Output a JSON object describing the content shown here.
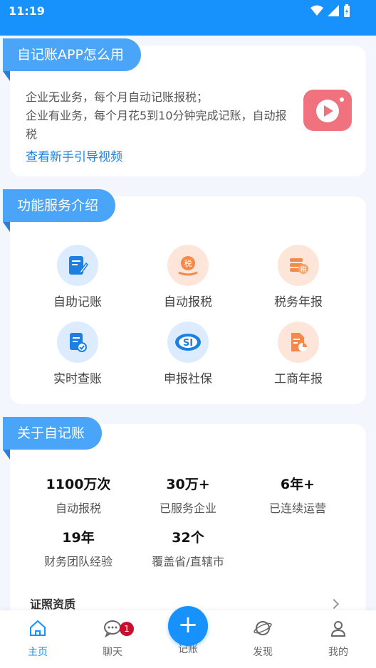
{
  "status": {
    "time": "11:19"
  },
  "intro": {
    "title": "自记账APP怎么用",
    "line1": "企业无业务，每个月自动记账报税；",
    "line2": "企业有业务，每个月花5到10分钟完成记账，自动报税",
    "link": "查看新手引导视频"
  },
  "features": {
    "title": "功能服务介绍",
    "items": [
      {
        "label": "自助记账",
        "icon": "edit-doc-icon",
        "color": "blue"
      },
      {
        "label": "自动报税",
        "icon": "tax-hand-icon",
        "color": "orange"
      },
      {
        "label": "税务年报",
        "icon": "tax-coins-icon",
        "color": "orange"
      },
      {
        "label": "实时查账",
        "icon": "check-doc-icon",
        "color": "blue"
      },
      {
        "label": "申报社保",
        "icon": "social-security-icon",
        "color": "blue"
      },
      {
        "label": "工商年报",
        "icon": "report-chart-icon",
        "color": "orange"
      }
    ],
    "small_tax_char": "税"
  },
  "about": {
    "title": "关于自记账",
    "stats": [
      {
        "num": "1100万次",
        "desc": "自动报税"
      },
      {
        "num": "30万+",
        "desc": "已服务企业"
      },
      {
        "num": "6年+",
        "desc": "已连续运营"
      },
      {
        "num": "19年",
        "desc": "财务团队经验"
      },
      {
        "num": "32个",
        "desc": "覆盖省/直辖市"
      }
    ],
    "license": "证照资质"
  },
  "tabbar": {
    "home": "主页",
    "chat": "聊天",
    "chat_badge": "1",
    "record": "记账",
    "discover": "发现",
    "mine": "我的",
    "fab": "+"
  },
  "colors": {
    "primary": "#1791fb",
    "ribbon": "#4aa4f7",
    "video": "#f0727e"
  }
}
